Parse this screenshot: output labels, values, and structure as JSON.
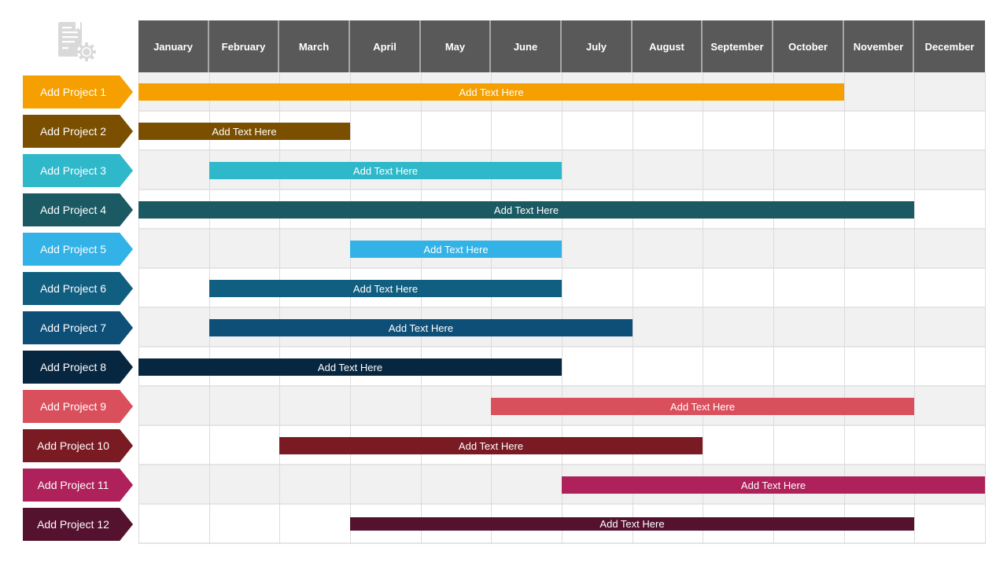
{
  "icon": "document-gear-icon",
  "bar_text": "Add Text Here",
  "chart_data": {
    "type": "gantt",
    "title": "",
    "months": [
      "January",
      "February",
      "March",
      "April",
      "May",
      "June",
      "July",
      "August",
      "September",
      "October",
      "November",
      "December"
    ],
    "tasks": [
      {
        "name": "Add Project 1",
        "text": "Add Text Here",
        "start": "January",
        "end": "October",
        "color": "#F5A000"
      },
      {
        "name": "Add Project 2",
        "text": "Add Text Here",
        "start": "January",
        "end": "March",
        "color": "#7B4F00"
      },
      {
        "name": "Add Project 3",
        "text": "Add Text Here",
        "start": "February",
        "end": "June",
        "color": "#2EB8CA"
      },
      {
        "name": "Add Project 4",
        "text": "Add Text Here",
        "start": "January",
        "end": "November",
        "color": "#1B5A63"
      },
      {
        "name": "Add Project 5",
        "text": "Add Text Here",
        "start": "April",
        "end": "June",
        "color": "#32B2E6"
      },
      {
        "name": "Add Project 6",
        "text": "Add Text Here",
        "start": "February",
        "end": "June",
        "color": "#105E80"
      },
      {
        "name": "Add Project 7",
        "text": "Add Text Here",
        "start": "February",
        "end": "July",
        "color": "#0E4F78"
      },
      {
        "name": "Add Project 8",
        "text": "Add Text Here",
        "start": "January",
        "end": "June",
        "color": "#072740"
      },
      {
        "name": "Add Project 9",
        "text": "Add Text Here",
        "start": "June",
        "end": "November",
        "color": "#D94F5C"
      },
      {
        "name": "Add Project 10",
        "text": "Add Text Here",
        "start": "March",
        "end": "August",
        "color": "#7A1B24"
      },
      {
        "name": "Add Project 11",
        "text": "Add Text Here",
        "start": "July",
        "end": "December",
        "color": "#AE215A"
      },
      {
        "name": "Add Project 12",
        "text": "Add Text Here",
        "start": "April",
        "end": "November",
        "color": "#54122E"
      }
    ],
    "colors": {
      "header_bg": "#595959",
      "header_text": "#FFFFFF",
      "row_alt_bg": "#F1F1F1",
      "grid_line": "#DCDCDC",
      "icon": "#D9D9D9"
    }
  }
}
